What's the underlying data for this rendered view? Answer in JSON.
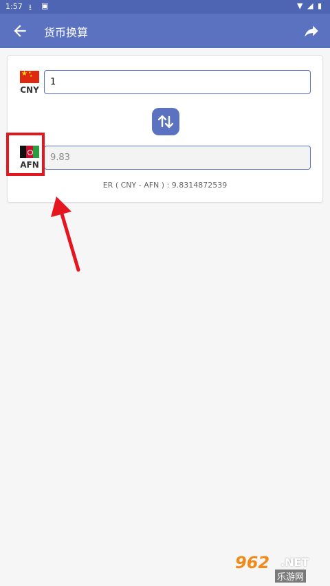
{
  "status_bar": {
    "time": "1:57"
  },
  "app_bar": {
    "title": "货币换算"
  },
  "converter": {
    "from": {
      "code": "CNY",
      "value": "1"
    },
    "to": {
      "code": "AFN",
      "value": "9.83"
    },
    "rate_text": "ER ( CNY - AFN ) :  9.8314872539"
  },
  "colors": {
    "primary": "#5a72c0",
    "status_bar": "#4d65b2",
    "highlight": "#e4161f"
  },
  "watermark": {
    "number": "962",
    "suffix": ".NET",
    "text": "乐游网"
  }
}
